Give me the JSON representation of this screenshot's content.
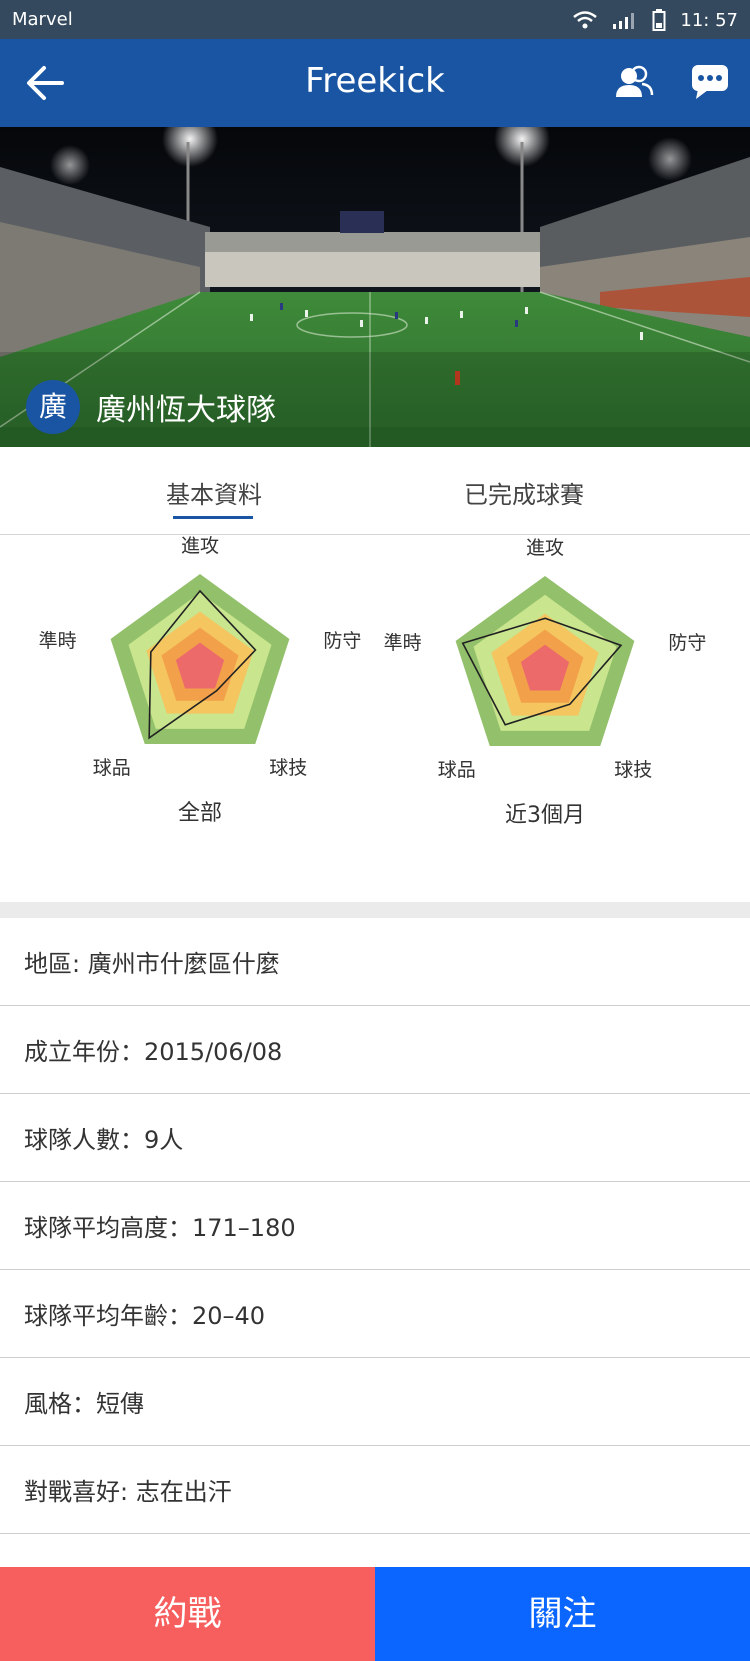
{
  "status_bar": {
    "carrier": "Marvel",
    "time": "11: 57"
  },
  "navbar": {
    "title": "Freekick"
  },
  "team": {
    "badge": "廣",
    "name": "廣州恆大球隊"
  },
  "tabs": [
    {
      "label": "基本資料",
      "active": true
    },
    {
      "label": "已完成球賽",
      "active": false
    }
  ],
  "radars": [
    {
      "caption": "全部",
      "axes": [
        "進攻",
        "防守",
        "球技",
        "球品",
        "準時"
      ],
      "values": [
        0.82,
        0.62,
        0.3,
        0.92,
        0.55
      ]
    },
    {
      "caption": "近3個月",
      "axes": [
        "進攻",
        "防守",
        "球技",
        "球品",
        "準時"
      ],
      "values": [
        0.55,
        0.85,
        0.45,
        0.72,
        0.92
      ]
    }
  ],
  "info": [
    {
      "text": "地區: 廣州市什麼區什麼"
    },
    {
      "text": "成立年份：2015/06/08"
    },
    {
      "text": "球隊人數：9人"
    },
    {
      "text": "球隊平均高度：171–180"
    },
    {
      "text": "球隊平均年齡：20–40"
    },
    {
      "text": "風格：短傳"
    },
    {
      "text": "對戰喜好: 志在出汗"
    }
  ],
  "footer": {
    "challenge_label": "約戰",
    "follow_label": "關注"
  },
  "colors": {
    "navbar": "#1a55a3",
    "status_bar": "#34495e",
    "challenge": "#f75e5e",
    "follow": "#0a66ff",
    "radar_rings": [
      "#93c06b",
      "#c9e58e",
      "#f5c560",
      "#f2a04a",
      "#ec6a6a"
    ]
  }
}
